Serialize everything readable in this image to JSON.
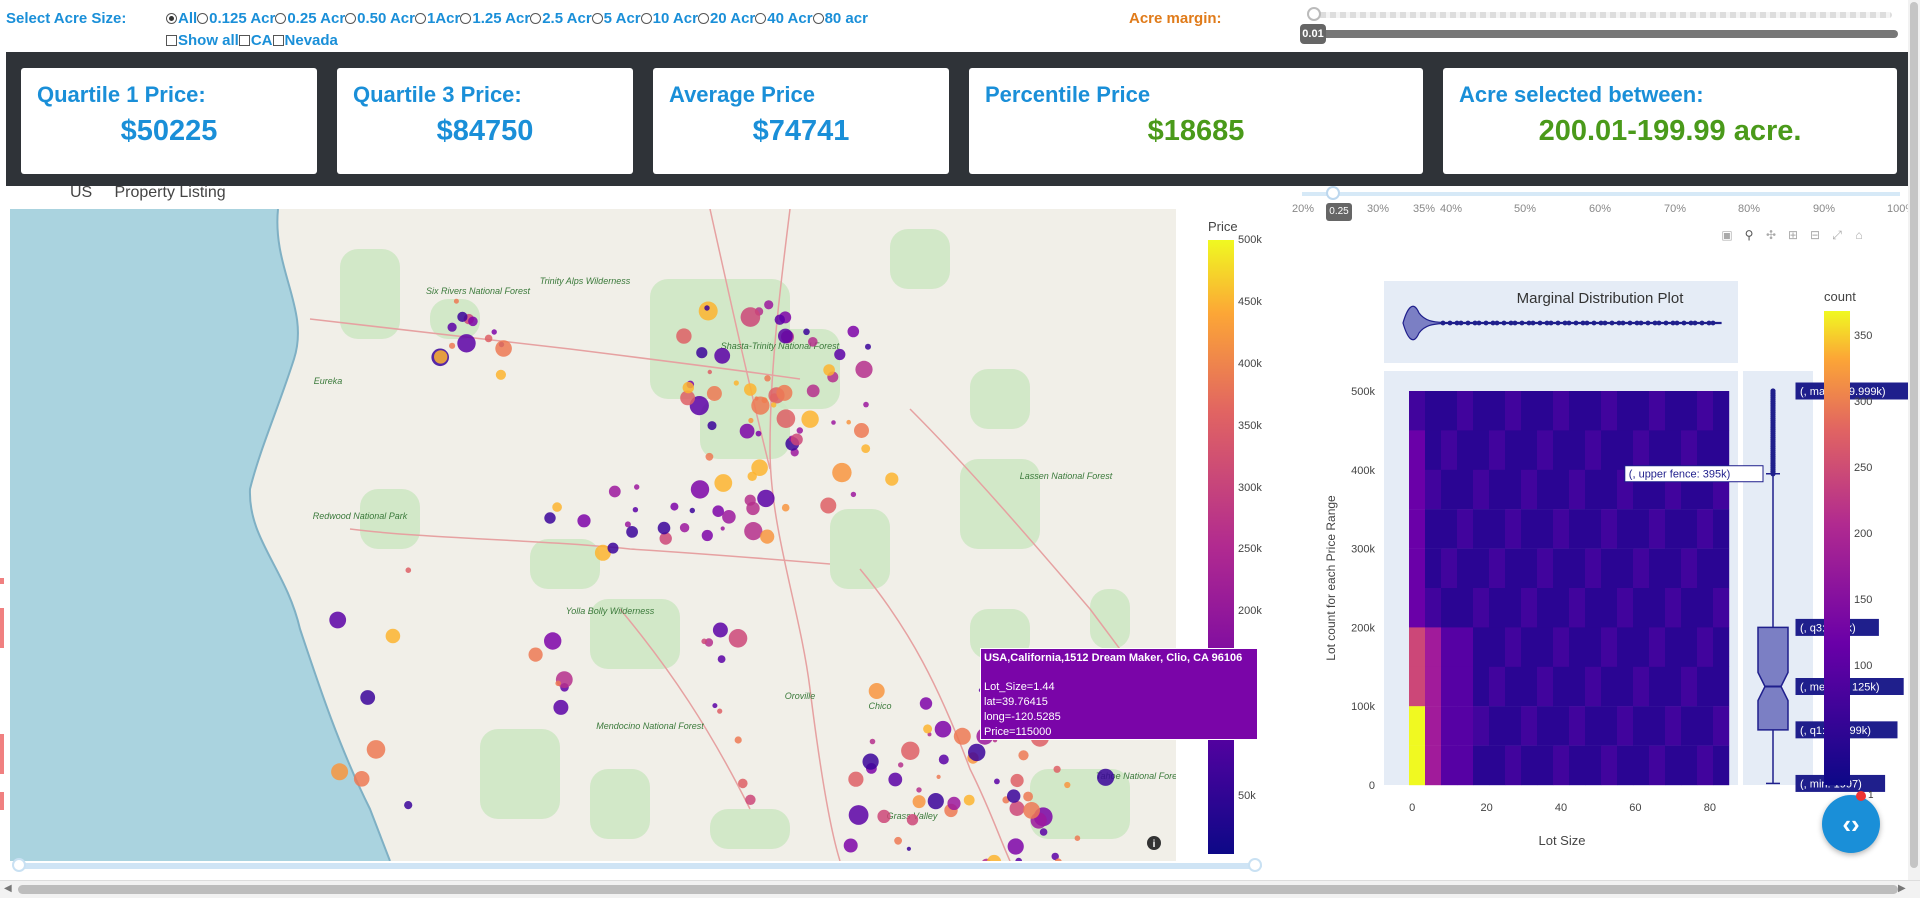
{
  "filters": {
    "select_label": "Select Acre Size:",
    "acre_options": [
      "All",
      "0.125 Acr",
      "0.25 Acr",
      "0.50 Acr",
      "1Acr",
      "1.25 Acr",
      "2.5 Acr",
      "5 Acr",
      "10 Acr",
      "20 Acr",
      "40 Acr",
      "80 acr"
    ],
    "acre_selected": "All",
    "checkbox_options": [
      "Show all",
      "CA",
      "Nevada"
    ],
    "margin_label": "Acre margin:",
    "margin_value": "0.01"
  },
  "kpis": {
    "q1_title": "Quartile 1 Price:",
    "q1_value": "$50225",
    "q3_title": "Quartile 3 Price:",
    "q3_value": "$84750",
    "avg_title": "Average Price",
    "avg_value": "$74741",
    "pct_title": "Percentile Price",
    "pct_value": "$18685",
    "acre_title": "Acre selected between:",
    "acre_value": "200.01-199.99 acre."
  },
  "map": {
    "title_country": "US",
    "title_text": "Property Listing",
    "colorbar_title": "Price",
    "colorbar_ticks": [
      "500k",
      "450k",
      "400k",
      "350k",
      "300k",
      "250k",
      "200k",
      "50k"
    ],
    "place_labels": [
      "Six Rivers National Forest",
      "Trinity Alps Wilderness",
      "Shasta-Trinity National Forest",
      "Lassen National Forest",
      "Yolla Bolly Wilderness",
      "Mendocino National Forest",
      "Tahoe National Forest",
      "Redwood National Park",
      "Eureka",
      "Chico",
      "Oroville",
      "Grass Valley"
    ],
    "tooltip": {
      "address": "USA,California,1512 Dream Maker, Clio, CA 96106",
      "lot_size": "Lot_Size=1.44",
      "lat": "lat=39.76415",
      "long": "long=-120.5285",
      "price": "Price=115000"
    },
    "colors": {
      "low": "#2a0d8f",
      "mid": "#b52c8c",
      "high": "#f5e426",
      "ocean": "#aad3df"
    }
  },
  "percentile_slider": {
    "ticks": [
      "20%",
      "30%",
      "35%",
      "40%",
      "50%",
      "60%",
      "70%",
      "80%",
      "90%",
      "100%"
    ],
    "value": "0.25"
  },
  "chart_data": {
    "type": "heatmap",
    "title": "Marginal Distribution Plot",
    "xlabel": "Lot Size",
    "ylabel": "Lot count for each Price Range",
    "x_ticks": [
      "0",
      "20",
      "40",
      "60",
      "80"
    ],
    "y_ticks": [
      "0",
      "100k",
      "200k",
      "300k",
      "400k",
      "500k"
    ],
    "xlim": [
      -3,
      83
    ],
    "ylim": [
      0,
      500000
    ],
    "colorbar_title": "count",
    "colorbar_ticks": [
      "350",
      "300",
      "250",
      "200",
      "150",
      "100"
    ],
    "box_annotations": [
      "(, max: 499.999k)",
      "(, upper fence: 395k)",
      "(, q3: 200k)",
      "(, median: 125k)",
      "(, q1: 69.999k)",
      "(, min: 1997)"
    ],
    "box": {
      "min": 1997,
      "q1": 69999,
      "median": 125000,
      "q3": 200000,
      "upper_fence": 395000,
      "max": 499999
    }
  }
}
